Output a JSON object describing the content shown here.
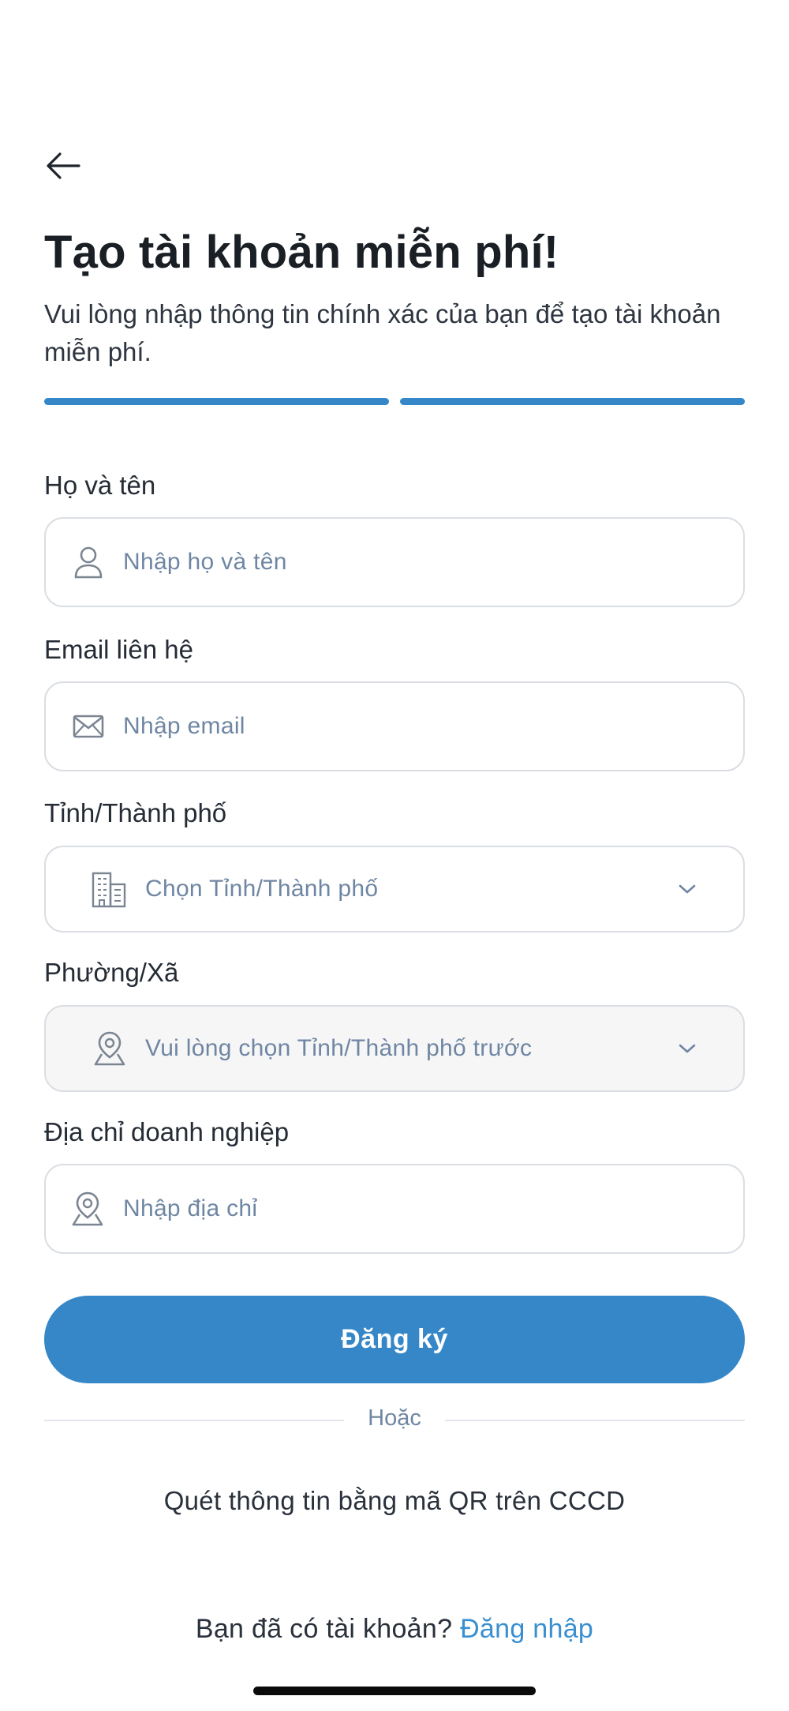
{
  "header": {
    "back_icon": "arrow-left-icon",
    "title": "Tạo tài khoản miễn phí!",
    "subtitle": "Vui lòng nhập thông tin chính xác của bạn để tạo tài khoản miễn phí."
  },
  "progress": {
    "total_steps": 2,
    "completed_steps": 2,
    "active_color": "#3587c8"
  },
  "form": {
    "full_name": {
      "label": "Họ và tên",
      "placeholder": "Nhập họ và tên",
      "icon": "user-icon",
      "value": ""
    },
    "email": {
      "label": "Email liên hệ",
      "placeholder": "Nhập email",
      "icon": "mail-icon",
      "value": ""
    },
    "province": {
      "label": "Tỉnh/Thành phố",
      "placeholder": "Chọn Tỉnh/Thành phố",
      "icon": "building-icon",
      "dropdown_icon": "chevron-down-icon"
    },
    "ward": {
      "label": "Phường/Xã",
      "placeholder": "Vui lòng chọn Tỉnh/Thành phố trước",
      "icon": "map-pin-icon",
      "dropdown_icon": "chevron-down-icon",
      "disabled": true
    },
    "address": {
      "label": "Địa chỉ doanh nghiệp",
      "placeholder": "Nhập địa chỉ",
      "icon": "map-pin-icon",
      "value": ""
    }
  },
  "actions": {
    "submit_label": "Đăng ký",
    "submit_color": "#3587c8",
    "divider_text": "Hoặc",
    "qr_label": "Quét thông tin bằng mã QR trên CCCD"
  },
  "footer": {
    "prompt": "Bạn đã có tài khoản?",
    "login_link": "Đăng nhập",
    "link_color": "#3a8fd0"
  }
}
